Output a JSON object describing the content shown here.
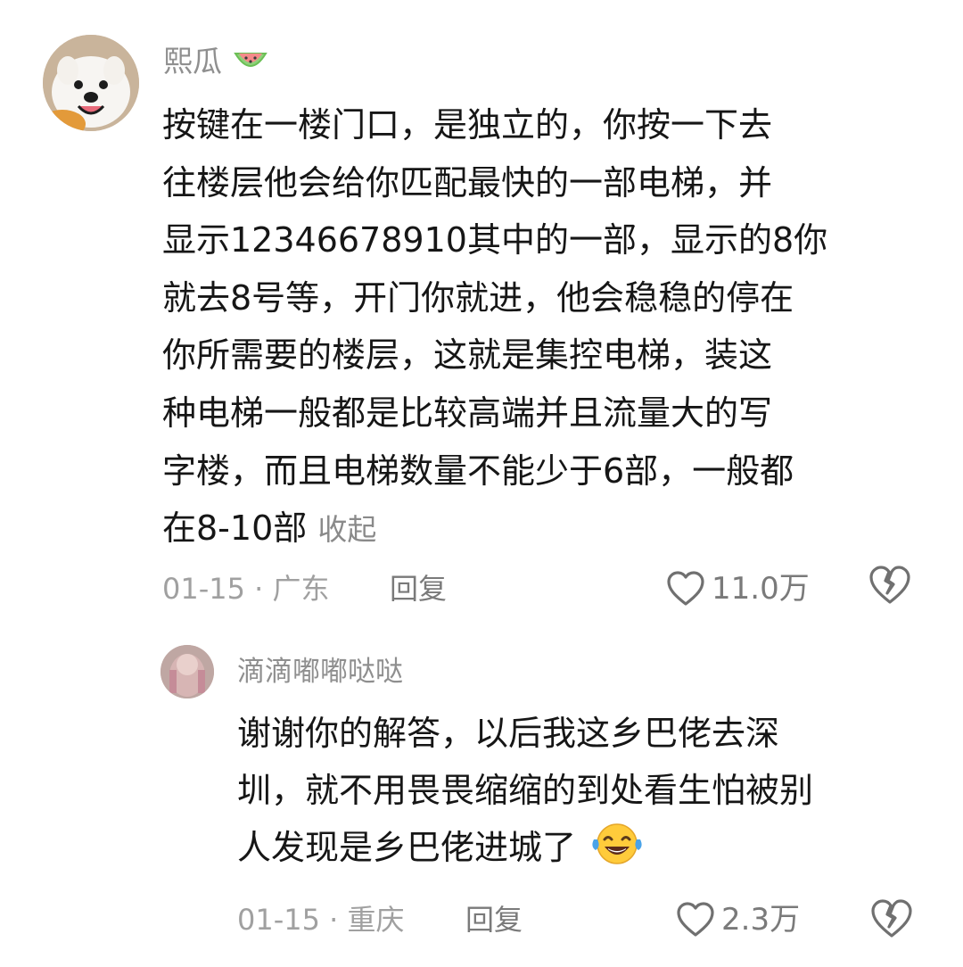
{
  "comments": [
    {
      "username": "熙瓜",
      "username_emoji": "watermelon-emoji",
      "text_lines": [
        "按键在一楼门口，是独立的，你按一下去",
        "往楼层他会给你匹配最快的一部电梯，并",
        "显示12346678910其中的一部，显示的8你",
        "就去8号等，开门你就进，他会稳稳的停在",
        "你所需要的楼层，这就是集控电梯，装这",
        "种电梯一般都是比较高端并且流量大的写",
        "字楼，而且电梯数量不能少于6部，一般都",
        "在8-10部"
      ],
      "collapse_label": "收起",
      "date": "01-15",
      "location": "广东",
      "meta": "01-15 · 广东",
      "reply_label": "回复",
      "like_count": "11.0万"
    },
    {
      "username": "滴滴嘟嘟哒哒",
      "text_lines": [
        "谢谢你的解答，以后我这乡巴佬去深",
        "圳，就不用畏畏缩缩的到处看生怕被别",
        "人发现是乡巴佬进城了"
      ],
      "trailing_emoji": "laughing-tears-emoji",
      "date": "01-15",
      "location": "重庆",
      "meta": "01-15 · 重庆",
      "reply_label": "回复",
      "like_count": "2.3万"
    }
  ]
}
